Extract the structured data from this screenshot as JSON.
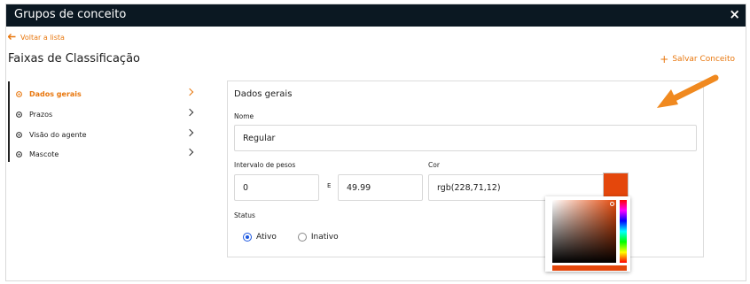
{
  "window": {
    "title": "Grupos de conceito",
    "close_icon": "×"
  },
  "back_link": {
    "label": "Voltar a lista"
  },
  "page_title": "Faixas de Classificação",
  "save_button": {
    "label": "Salvar Conceito"
  },
  "sidebar": {
    "items": [
      {
        "label": "Dados gerais",
        "active": true
      },
      {
        "label": "Prazos",
        "active": false
      },
      {
        "label": "Visão do agente",
        "active": false
      },
      {
        "label": "Mascote",
        "active": false
      }
    ]
  },
  "panel": {
    "title": "Dados gerais",
    "nome": {
      "label": "Nome",
      "value": "Regular"
    },
    "intervalo": {
      "label": "Intervalo de pesos",
      "from": "0",
      "separator": "E",
      "to": "49.99"
    },
    "cor": {
      "label": "Cor",
      "value": "rgb(228,71,12)",
      "swatch_color": "#e4470c"
    },
    "status": {
      "label": "Status",
      "options": [
        {
          "label": "Ativo",
          "checked": true
        },
        {
          "label": "Inativo",
          "checked": false
        }
      ]
    }
  },
  "colors": {
    "accent": "#e8770e",
    "titlebar": "#0b1822",
    "radio": "#1a56e0"
  }
}
